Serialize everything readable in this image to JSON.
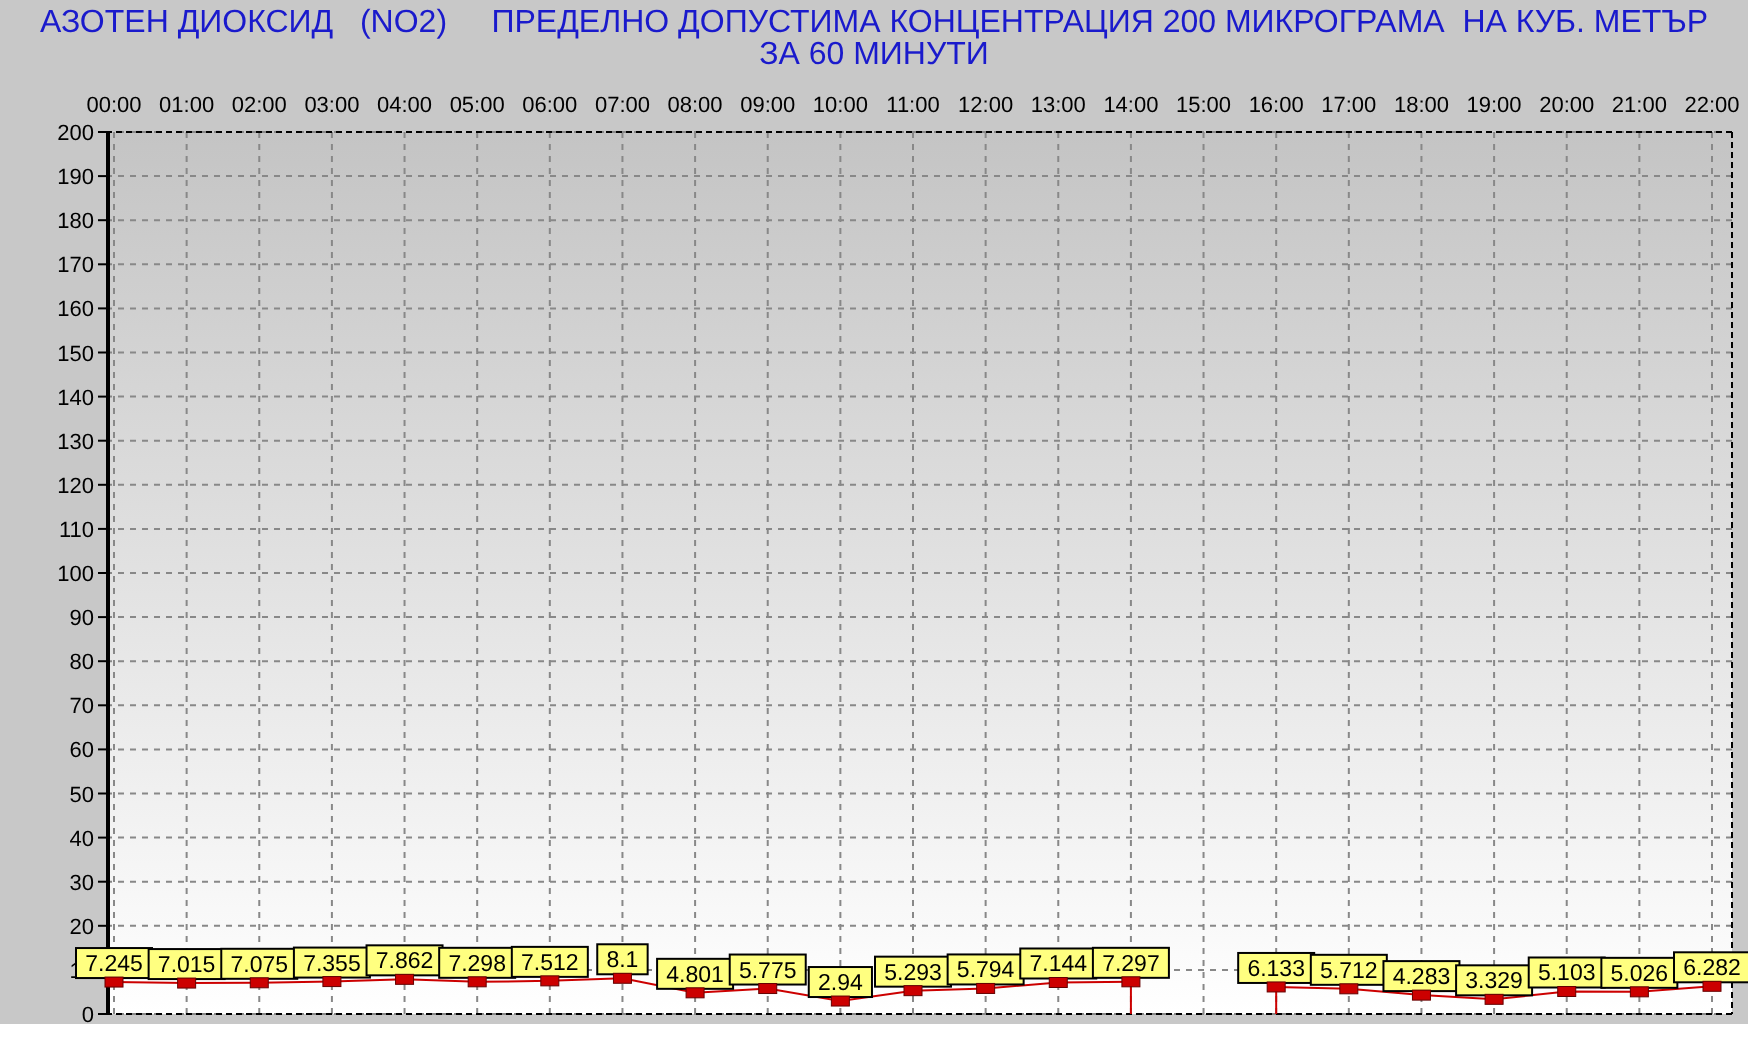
{
  "chart_data": {
    "type": "line",
    "title": "АЗОТЕН ДИОКСИД   (NO2)     ПРЕДЕЛНО ДОПУСТИМА КОНЦЕНТРАЦИЯ 200 МИКРОГРАМА  НА КУБ. МЕТЪР\nЗА 60 МИНУТИ",
    "categories": [
      "00:00",
      "01:00",
      "02:00",
      "03:00",
      "04:00",
      "05:00",
      "06:00",
      "07:00",
      "08:00",
      "09:00",
      "10:00",
      "11:00",
      "12:00",
      "13:00",
      "14:00",
      "15:00",
      "16:00",
      "17:00",
      "18:00",
      "19:00",
      "20:00",
      "21:00",
      "22:00"
    ],
    "grid": true,
    "series": [
      {
        "color": "#cc0000",
        "marker": "square",
        "values": [
          7.245,
          7.015,
          7.075,
          7.355,
          7.862,
          7.298,
          7.512,
          8.1,
          4.801,
          5.775,
          2.94,
          5.293,
          5.794,
          7.144,
          7.297,
          null,
          6.133,
          5.712,
          4.283,
          3.329,
          5.103,
          5.026,
          6.282
        ]
      }
    ],
    "value_labels": [
      "7.245",
      "7.015",
      "7.075",
      "7.355",
      "7.862",
      "7.298",
      "7.512",
      "8.1",
      "4.801",
      "5.775",
      "2.94",
      "5.293",
      "5.794",
      "7.144",
      "7.297",
      null,
      "6.133",
      "5.712",
      "4.283",
      "3.329",
      "5.103",
      "5.026",
      "6.282"
    ],
    "ylim": [
      0,
      200
    ],
    "yticks": [
      0,
      10,
      20,
      30,
      40,
      50,
      60,
      70,
      80,
      90,
      100,
      110,
      120,
      130,
      140,
      150,
      160,
      170,
      180,
      190,
      200
    ],
    "data_labels": true
  }
}
